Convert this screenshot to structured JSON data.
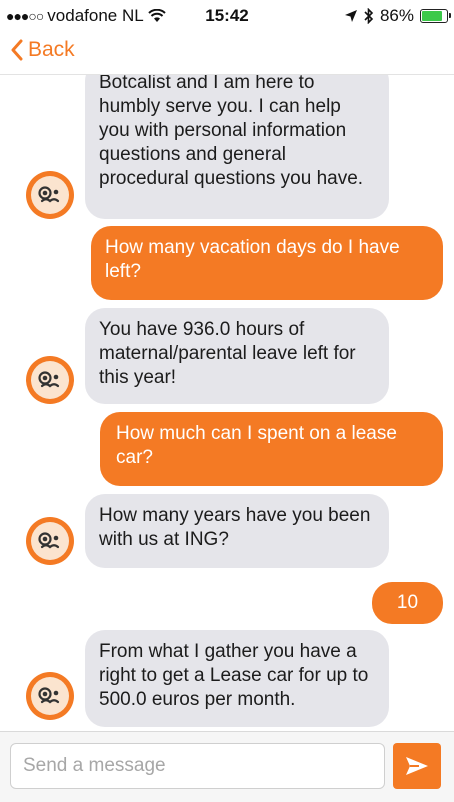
{
  "status_bar": {
    "carrier": "vodafone NL",
    "time": "15:42",
    "battery": "86%",
    "battery_level": 0.86
  },
  "nav": {
    "back_label": "Back"
  },
  "messages": [
    {
      "sender": "bot",
      "text": "Botcalist and I am here to humbly serve you. I can help you with personal information questions and general procedural questions you have."
    },
    {
      "sender": "user",
      "text": "How many vacation days do I have left?"
    },
    {
      "sender": "bot",
      "text": "You have 936.0 hours of maternal/parental leave left for this year!"
    },
    {
      "sender": "user",
      "text": "How much can I spent on a lease car?"
    },
    {
      "sender": "bot",
      "text": "How many years have you been with us at ING?"
    },
    {
      "sender": "user",
      "text": "10"
    },
    {
      "sender": "bot",
      "text": "From what I gather you have a right to get a Lease car for up to 500.0 euros per month."
    }
  ],
  "composer": {
    "placeholder": "Send a message"
  },
  "colors": {
    "accent": "#f47a24",
    "bot_bubble": "#e5e5ea"
  },
  "icons": {
    "back": "chevron-left-icon",
    "send": "send-arrow-icon",
    "bluetooth": "bluetooth-icon",
    "location": "location-arrow-icon",
    "wifi": "wifi-icon",
    "avatar": "bot-monocle-face-icon"
  }
}
